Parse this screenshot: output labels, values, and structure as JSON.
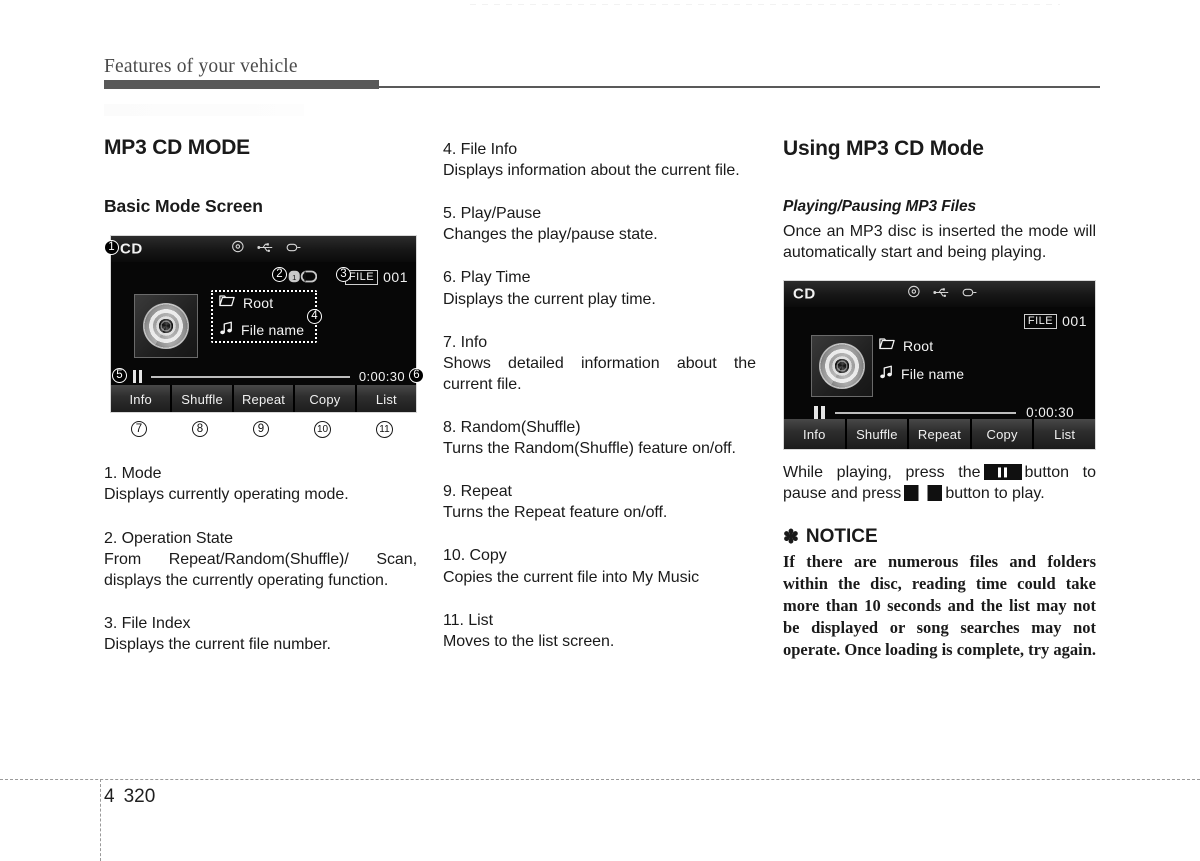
{
  "page": {
    "running_header": "Features of your vehicle",
    "chapter_number": "4",
    "page_number": "320"
  },
  "column_left": {
    "section_title": "MP3 CD MODE",
    "sub_title": "Basic Mode Screen",
    "items": [
      {
        "head": "1. Mode",
        "body": "Displays currently operating mode."
      },
      {
        "head": "2. Operation State",
        "body": "From Repeat/Random(Shuffle)/ Scan, displays the currently operating function."
      },
      {
        "head": "3. File Index",
        "body": "Displays the current file number."
      }
    ]
  },
  "column_mid": {
    "items": [
      {
        "head": "4. File Info",
        "body": "Displays information about the current file."
      },
      {
        "head": "5. Play/Pause",
        "body": "Changes the play/pause state."
      },
      {
        "head": "6. Play Time",
        "body": "Displays the current play time."
      },
      {
        "head": "7. Info",
        "body": "Shows detailed information about the current file."
      },
      {
        "head": "8. Random(Shuffle)",
        "body": "Turns the Random(Shuffle) feature on/off."
      },
      {
        "head": "9. Repeat",
        "body": "Turns the Repeat feature on/off."
      },
      {
        "head": "10. Copy",
        "body": "Copies the current file into My Music"
      },
      {
        "head": "11. List",
        "body": "Moves to the list screen."
      }
    ]
  },
  "column_right": {
    "section_title": "Using MP3 CD Mode",
    "sub_title": "Playing/Pausing MP3 Files",
    "intro": "Once an MP3 disc is inserted the mode will automatically start and being playing.",
    "instruction_part1": "While playing, press the",
    "instruction_part2": "button to pause and press",
    "instruction_part3": "button to play.",
    "notice": {
      "star": "✽",
      "title": "NOTICE",
      "body": "If there are numerous files and folders within the disc, reading time could take more than 10 seconds and the list may not be displayed or song searches may not operate. Once loading is complete, try again."
    }
  },
  "device_screen_annotated": {
    "mode_label": "CD",
    "top_icons": [
      "disc-icon",
      "usb-icon",
      "ipod-icon"
    ],
    "operation_state_icon": "repeat-one-icon",
    "file_tag": "FILE",
    "file_number": "001",
    "folder_label": "Root",
    "file_label": "File name",
    "transport_state": "pause-icon",
    "play_time": "0:00:30",
    "buttons": [
      "Info",
      "Shuffle",
      "Repeat",
      "Copy",
      "List"
    ],
    "callouts": [
      "1",
      "2",
      "3",
      "4",
      "5",
      "6",
      "7",
      "8",
      "9",
      "10",
      "11"
    ]
  },
  "device_screen_plain": {
    "mode_label": "CD",
    "top_icons": [
      "disc-icon",
      "usb-icon",
      "ipod-icon"
    ],
    "file_tag": "FILE",
    "file_number": "001",
    "folder_label": "Root",
    "file_label": "File name",
    "transport_state": "pause-icon",
    "play_time": "0:00:30",
    "buttons": [
      "Info",
      "Shuffle",
      "Repeat",
      "Copy",
      "List"
    ]
  },
  "colors": {
    "rule": "#595959",
    "header_text": "#4a4a4a",
    "screen_bg": "#070707",
    "screen_text": "#f2f2f2"
  }
}
